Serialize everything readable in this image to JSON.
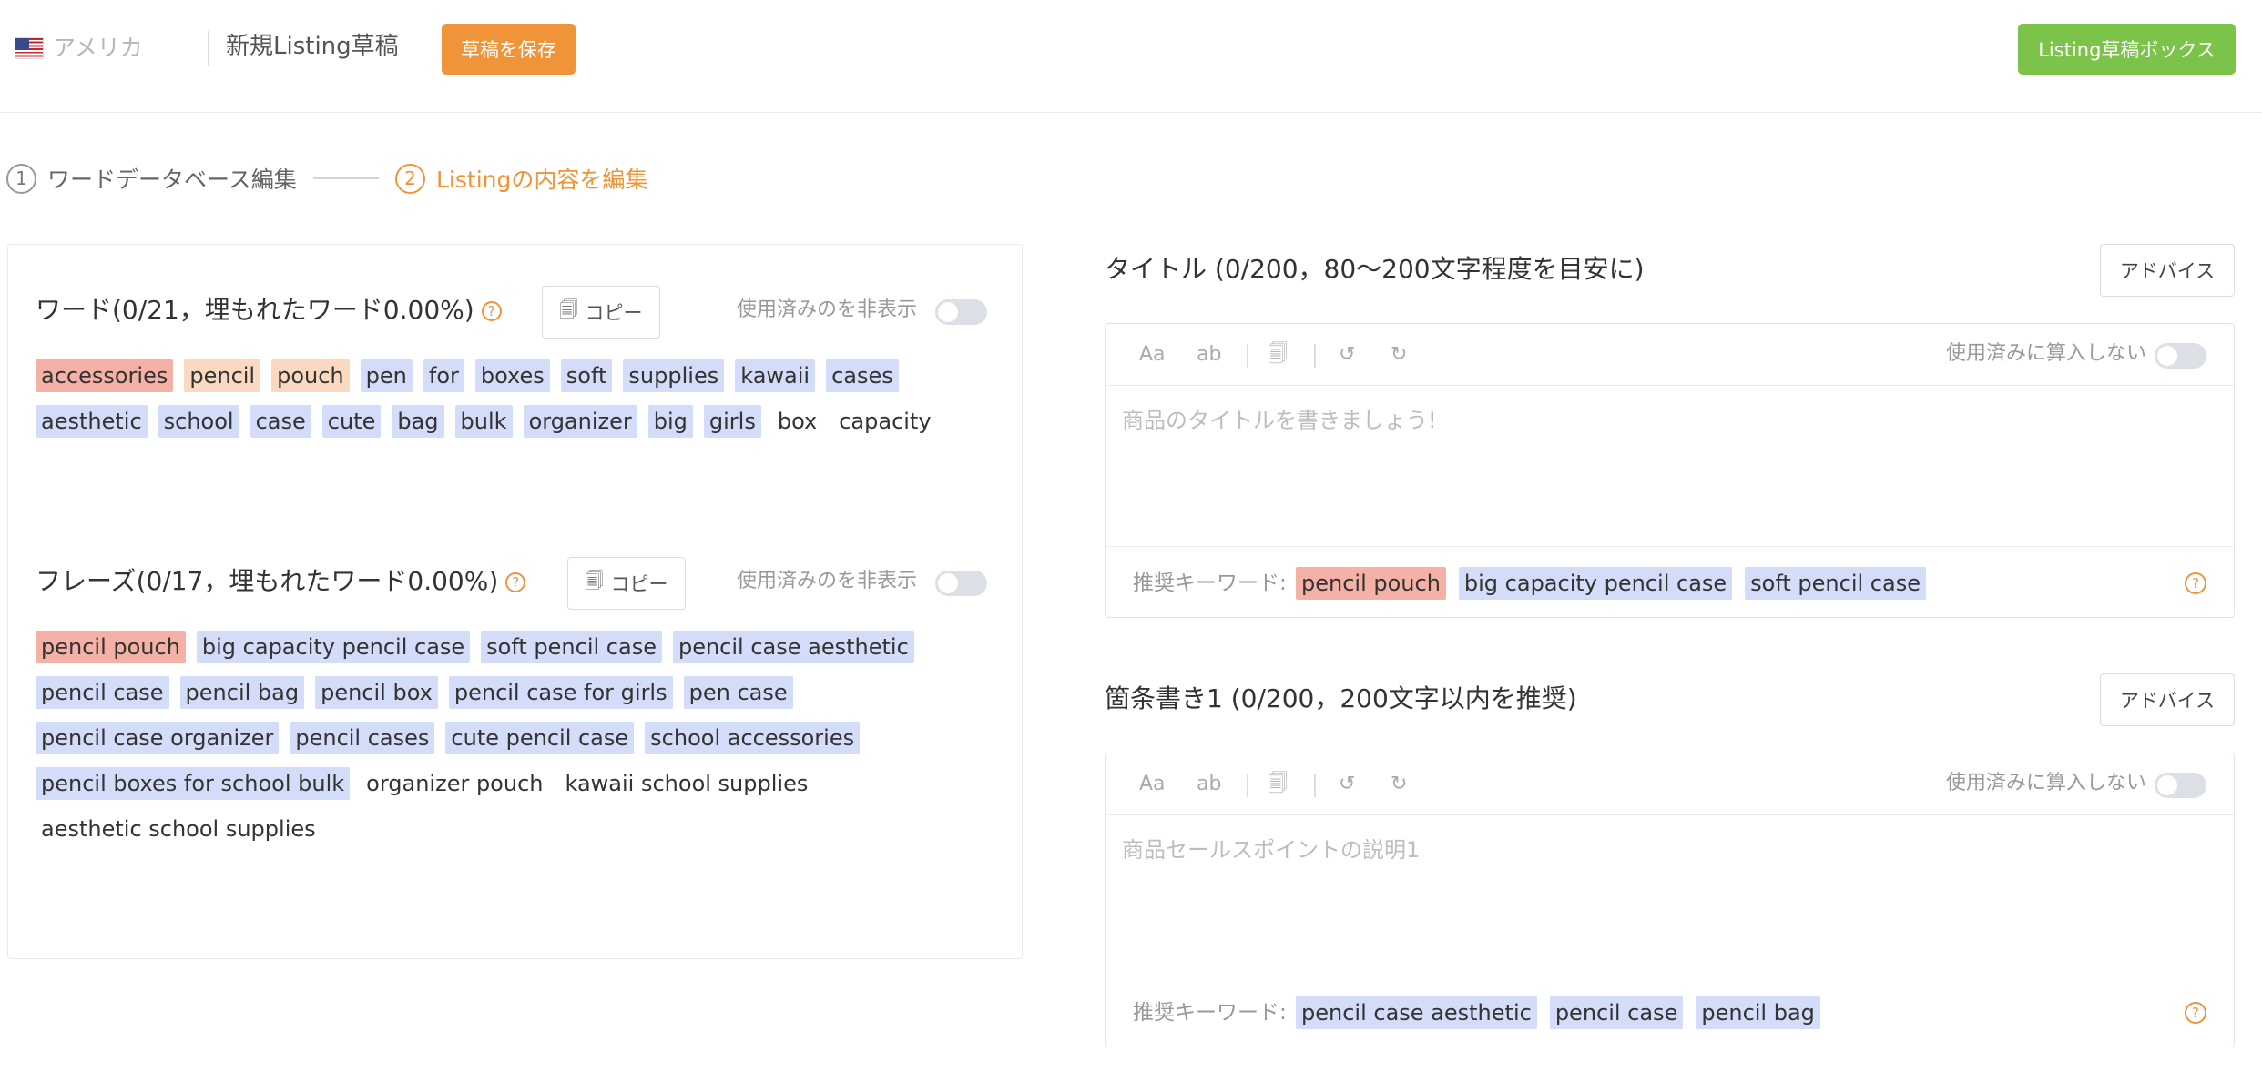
{
  "header": {
    "country": "アメリカ",
    "draft_title": "新規Listing草稿",
    "save_label": "草稿を保存",
    "box_label": "Listing草稿ボックス",
    "colors": {
      "save": "#ef9438",
      "box": "#7cc349"
    }
  },
  "steps": [
    {
      "number": "1",
      "label": "ワードデータベース編集"
    },
    {
      "number": "2",
      "label": "Listingの内容を編集"
    }
  ],
  "words": {
    "title": "ワード(0/21，埋もれたワード0.00%)",
    "copy_label": "コピー",
    "hide_used_label": "使用済みのを非表示",
    "tags": [
      {
        "text": "accessories",
        "tone": "red"
      },
      {
        "text": "pencil",
        "tone": "peach"
      },
      {
        "text": "pouch",
        "tone": "peach"
      },
      {
        "text": "pen",
        "tone": "blue"
      },
      {
        "text": "for",
        "tone": "blue"
      },
      {
        "text": "boxes",
        "tone": "blue"
      },
      {
        "text": "soft",
        "tone": "blue"
      },
      {
        "text": "supplies",
        "tone": "blue"
      },
      {
        "text": "kawaii",
        "tone": "blue"
      },
      {
        "text": "cases",
        "tone": "blue"
      },
      {
        "text": "aesthetic",
        "tone": "blue"
      },
      {
        "text": "school",
        "tone": "blue"
      },
      {
        "text": "case",
        "tone": "blue"
      },
      {
        "text": "cute",
        "tone": "blue"
      },
      {
        "text": "bag",
        "tone": "blue"
      },
      {
        "text": "bulk",
        "tone": "blue"
      },
      {
        "text": "organizer",
        "tone": "blue"
      },
      {
        "text": "big",
        "tone": "blue"
      },
      {
        "text": "girls",
        "tone": "blue"
      },
      {
        "text": "box",
        "tone": "plain"
      },
      {
        "text": "capacity",
        "tone": "plain"
      }
    ]
  },
  "phrases": {
    "title": "フレーズ(0/17，埋もれたワード0.00%)",
    "copy_label": "コピー",
    "hide_used_label": "使用済みのを非表示",
    "tags": [
      {
        "text": "pencil pouch",
        "tone": "red"
      },
      {
        "text": "big capacity pencil case",
        "tone": "blue"
      },
      {
        "text": "soft pencil case",
        "tone": "blue"
      },
      {
        "text": "pencil case aesthetic",
        "tone": "blue"
      },
      {
        "text": "pencil case",
        "tone": "blue"
      },
      {
        "text": "pencil bag",
        "tone": "blue"
      },
      {
        "text": "pencil box",
        "tone": "blue"
      },
      {
        "text": "pencil case for girls",
        "tone": "blue"
      },
      {
        "text": "pen case",
        "tone": "blue"
      },
      {
        "text": "pencil case organizer",
        "tone": "blue"
      },
      {
        "text": "pencil cases",
        "tone": "blue"
      },
      {
        "text": "cute pencil case",
        "tone": "blue"
      },
      {
        "text": "school accessories",
        "tone": "blue"
      },
      {
        "text": "pencil boxes for school bulk",
        "tone": "blue"
      },
      {
        "text": "organizer pouch",
        "tone": "plain"
      },
      {
        "text": "kawaii school supplies",
        "tone": "plain"
      },
      {
        "text": "aesthetic school supplies",
        "tone": "plain"
      }
    ]
  },
  "title_editor": {
    "heading": "タイトル (0/200，80～200文字程度を目安に)",
    "advice_label": "アドバイス",
    "toolbar": {
      "case_upper": "Aa",
      "case_lower": "ab",
      "count_toggle_label": "使用済みに算入しない"
    },
    "placeholder": "商品のタイトルを書きましょう!",
    "keyword_label": "推奨キーワード:",
    "keywords": [
      {
        "text": "pencil pouch",
        "tone": "red"
      },
      {
        "text": "big capacity pencil case",
        "tone": "blue"
      },
      {
        "text": "soft pencil case",
        "tone": "blue"
      }
    ]
  },
  "bullet_editor": {
    "heading": "箇条書き1 (0/200，200文字以内を推奨)",
    "advice_label": "アドバイス",
    "toolbar": {
      "case_upper": "Aa",
      "case_lower": "ab",
      "count_toggle_label": "使用済みに算入しない"
    },
    "placeholder": "商品セールスポイントの説明1",
    "keyword_label": "推奨キーワード:",
    "keywords": [
      {
        "text": "pencil case aesthetic",
        "tone": "blue"
      },
      {
        "text": "pencil case",
        "tone": "blue"
      },
      {
        "text": "pencil bag",
        "tone": "blue"
      }
    ]
  }
}
